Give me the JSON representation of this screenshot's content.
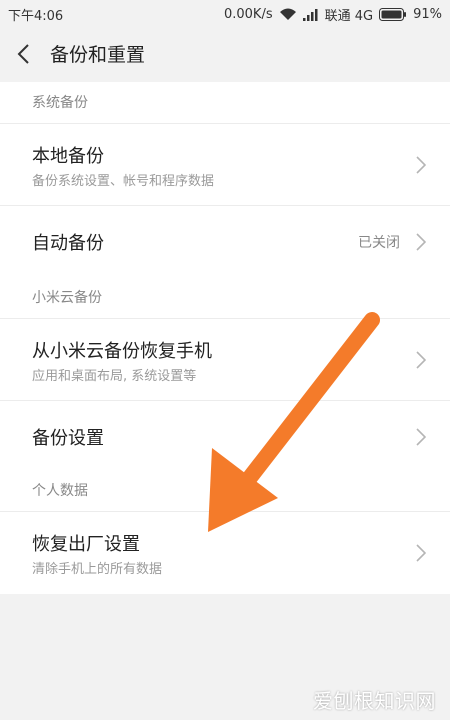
{
  "status_bar": {
    "time": "下午4:06",
    "network_speed": "0.00K/s",
    "carrier": "联通 4G",
    "battery": "91%"
  },
  "header": {
    "title": "备份和重置"
  },
  "sections": [
    {
      "header": "系统备份",
      "items": [
        {
          "title": "本地备份",
          "subtitle": "备份系统设置、帐号和程序数据"
        },
        {
          "title": "自动备份",
          "value": "已关闭"
        }
      ]
    },
    {
      "header": "小米云备份",
      "items": [
        {
          "title": "从小米云备份恢复手机",
          "subtitle": "应用和桌面布局, 系统设置等"
        },
        {
          "title": "备份设置"
        }
      ]
    },
    {
      "header": "个人数据",
      "items": [
        {
          "title": "恢复出厂设置",
          "subtitle": "清除手机上的所有数据"
        }
      ]
    }
  ],
  "annotation": {
    "arrow_color": "#f47b2a"
  },
  "watermark": "爱刨根知识网"
}
